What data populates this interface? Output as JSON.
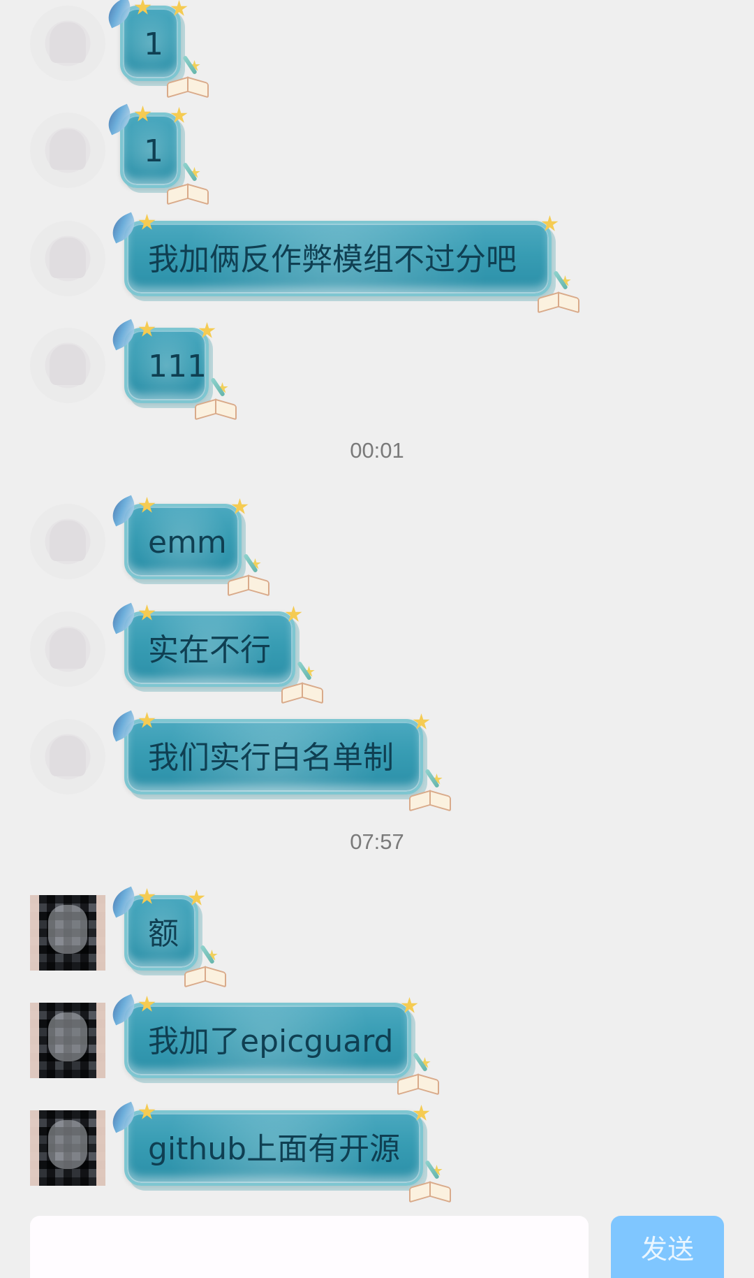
{
  "messages": [
    {
      "text": "1",
      "avatar": "placeholder-avatar-icon"
    },
    {
      "text": "1",
      "avatar": "placeholder-avatar-icon"
    },
    {
      "text": "我加俩反作弊模组不过分吧",
      "avatar": "placeholder-avatar-icon"
    },
    {
      "text": "111",
      "avatar": "placeholder-avatar-icon"
    },
    {
      "text": "emm",
      "avatar": "placeholder-avatar-icon"
    },
    {
      "text": "实在不行",
      "avatar": "placeholder-avatar-icon"
    },
    {
      "text": "我们实行白名单制",
      "avatar": "placeholder-avatar-icon"
    },
    {
      "text": "额",
      "avatar": "pixelated-profile-photo"
    },
    {
      "text": "我加了epicguard",
      "avatar": "pixelated-profile-photo"
    },
    {
      "text": "github上面有开源",
      "avatar": "pixelated-profile-photo"
    }
  ],
  "timestamps": [
    "00:01",
    "07:57"
  ],
  "composer": {
    "input_value": "",
    "send_label": "发送"
  },
  "colors": {
    "page_background": "#efefef",
    "bubble_fill": "#3da1b9",
    "bubble_text": "#0f3f52",
    "send_button": "#7fc6ff"
  }
}
